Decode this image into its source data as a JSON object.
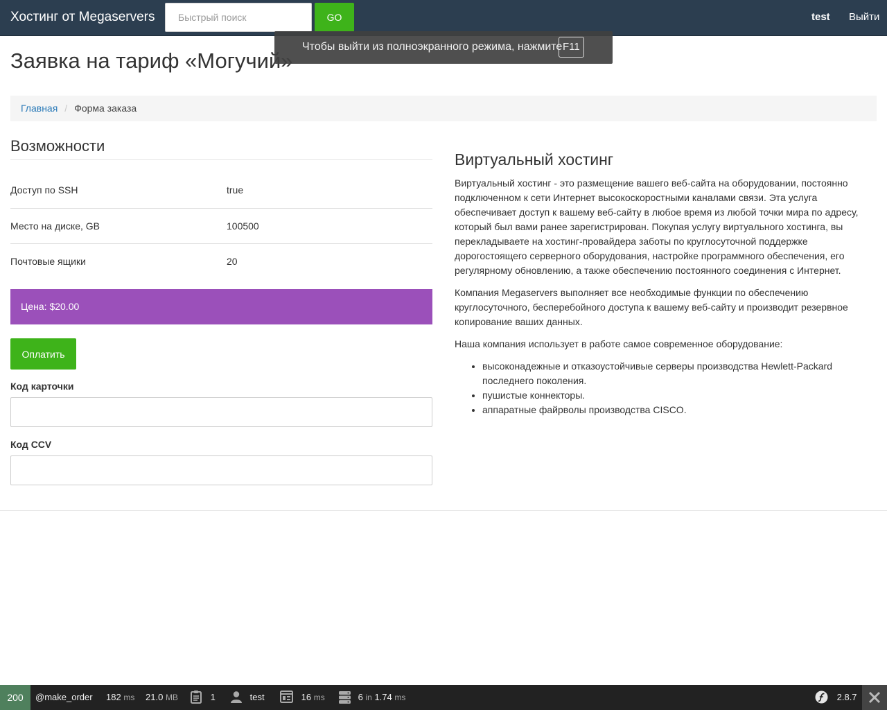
{
  "navbar": {
    "brand": "Хостинг от Megaservers",
    "search_placeholder": "Быстрый поиск",
    "go_label": "GO",
    "username": "test",
    "logout_label": "Выйти"
  },
  "fullscreen_toast": {
    "text": "Чтобы выйти из полноэкранного режима, нажмите",
    "key": "F11"
  },
  "page": {
    "title": "Заявка на тариф «Могучий»"
  },
  "breadcrumb": {
    "home": "Главная",
    "current": "Форма заказа"
  },
  "features": {
    "title": "Возможности",
    "rows": [
      {
        "label": "Доступ по SSH",
        "value": "true"
      },
      {
        "label": "Место на диске, GB",
        "value": "100500"
      },
      {
        "label": "Почтовые ящики",
        "value": "20"
      }
    ]
  },
  "order": {
    "price_label": "Цена: $20.00",
    "pay_button": "Оплатить",
    "card_label": "Код карточки",
    "card_value": "",
    "ccv_label": "Код CCV",
    "ccv_value": ""
  },
  "info": {
    "title": "Виртуальный хостинг",
    "paragraph_1": "Виртуальный хостинг - это размещение вашего веб-сайта на оборудовании, постоянно подключенном к сети Интернет высокоскоростными каналами связи. Эта услуга обеспечивает доступ к вашему веб-сайту в любое время из любой точки мира по адресу, который был вами ранее зарегистрирован. Покупая услугу виртуального хостинга, вы перекладываете на хостинг-провайдера заботы по круглосуточной поддержке дорогостоящего серверного оборудования, настройке программного обеспечения, его регулярному обновлению, а также обеспечению постоянного соединения с Интернет.",
    "paragraph_2": "Компания Megaservers выполняет все необходимые функции по обеспечению круглосуточного, бесперебойного доступа к вашему веб-сайту и производит резервное копирование ваших данных.",
    "paragraph_3": "Наша компания использует в работе самое современное оборудование:",
    "list": [
      "высоконадежные и отказоустойчивые серверы производства Hewlett-Packard последнего поколения.",
      "пушистые коннекторы.",
      "аппаратные файрволы производства CISCO."
    ]
  },
  "debug_toolbar": {
    "status": "200",
    "route": "make_order",
    "time_value": "182",
    "time_unit": "ms",
    "memory_value": "21.0",
    "memory_unit": "MB",
    "log_count": "1",
    "user": "test",
    "render_value": "16",
    "render_unit": "ms",
    "db_queries": "6",
    "db_in": "in",
    "db_time": "1.74",
    "db_unit": "ms",
    "version": "2.8.7"
  },
  "colors": {
    "navbar_bg": "#2c3e50",
    "accent_green": "#3eb31a",
    "price_purple": "#9b50ba",
    "link_blue": "#2a7ab8",
    "toolbar_bg": "#222222",
    "status_green": "#4f805d"
  }
}
